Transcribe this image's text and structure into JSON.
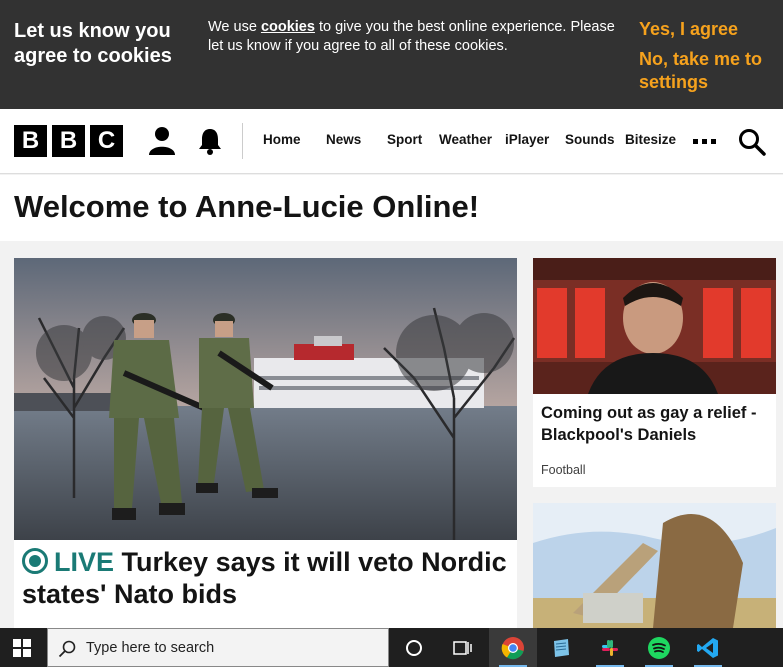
{
  "cookie_banner": {
    "title": "Let us know you agree to cookies",
    "text_before": "We use ",
    "text_link": "cookies",
    "text_after": " to give you the best online experience. Please let us know if you agree to all of these cookies.",
    "agree_label": "Yes, I agree",
    "settings_label": "No, take me to settings"
  },
  "header": {
    "logo_letters": [
      "B",
      "B",
      "C"
    ],
    "nav": [
      "Home",
      "News",
      "Sport",
      "Weather",
      "iPlayer",
      "Sounds",
      "Bitesize"
    ],
    "icons": [
      "user-icon",
      "bell-icon",
      "more-icon",
      "search-icon"
    ]
  },
  "welcome_title": "Welcome to Anne-Lucie Online!",
  "main_story": {
    "live_label": "LIVE",
    "headline": "Turkey says it will veto Nordic states' Nato bids"
  },
  "side_story": {
    "headline": "Coming out as gay a relief - Blackpool's Daniels",
    "tag": "Football"
  },
  "taskbar": {
    "search_placeholder": "Type here to search",
    "apps": [
      "cortana-icon",
      "task-view-icon",
      "chrome-icon",
      "notepad-icon",
      "slack-icon",
      "spotify-icon",
      "vscode-icon"
    ]
  },
  "colors": {
    "cookie_accent": "#f6a21d",
    "live": "#1a7a75",
    "banner_bg": "#323232"
  }
}
